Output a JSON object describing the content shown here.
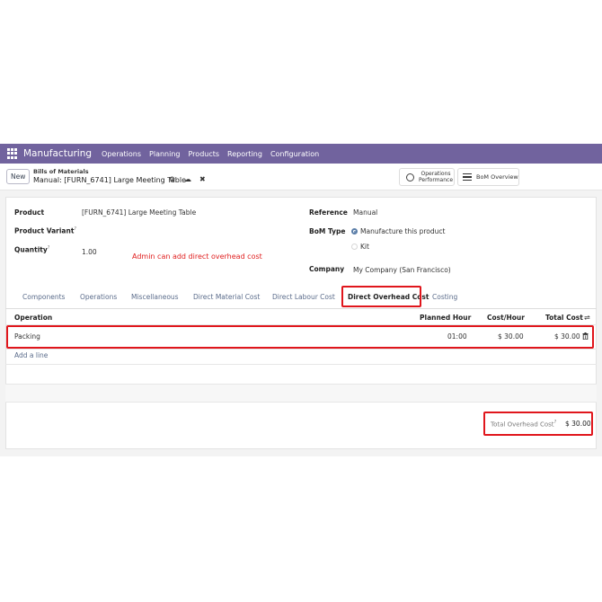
{
  "navbar": {
    "app_name": "Manufacturing",
    "menus": [
      "Operations",
      "Planning",
      "Products",
      "Reporting",
      "Configuration"
    ]
  },
  "control": {
    "new_label": "New",
    "breadcrumb_parent": "Bills of Materials",
    "breadcrumb_current": "Manual: [FURN_6741] Large Meeting Table",
    "ops_perf_line1": "Operations",
    "ops_perf_line2": "Performance",
    "bom_overview": "BoM Overview"
  },
  "form": {
    "product_label": "Product",
    "product_value": "[FURN_6741] Large Meeting Table",
    "variant_label": "Product Variant",
    "quantity_label": "Quantity",
    "quantity_value": "1.00",
    "help_mark": "?",
    "annotation": "Admin can add direct overhead cost",
    "reference_label": "Reference",
    "reference_value": "Manual",
    "bom_type_label": "BoM Type",
    "bom_type_options": [
      "Manufacture this product",
      "Kit"
    ],
    "company_label": "Company",
    "company_value": "My Company (San Francisco)"
  },
  "tabs": [
    "Components",
    "Operations",
    "Miscellaneous",
    "Direct Material Cost",
    "Direct Labour Cost",
    "Direct Overhead Cost",
    "Costing"
  ],
  "table": {
    "headers": {
      "operation": "Operation",
      "planned_hour": "Planned Hour",
      "cost_hour": "Cost/Hour",
      "total_cost": "Total Cost"
    },
    "rows": [
      {
        "operation": "Packing",
        "planned_hour": "01:00",
        "cost_hour": "$ 30.00",
        "total_cost": "$ 30.00"
      }
    ],
    "add_line": "Add a line"
  },
  "total": {
    "label": "Total Overhead Cost",
    "value": "$ 30.00"
  },
  "colors": {
    "navbar": "#71639e",
    "highlight": "#e0161c",
    "link": "#5b6c8b"
  }
}
